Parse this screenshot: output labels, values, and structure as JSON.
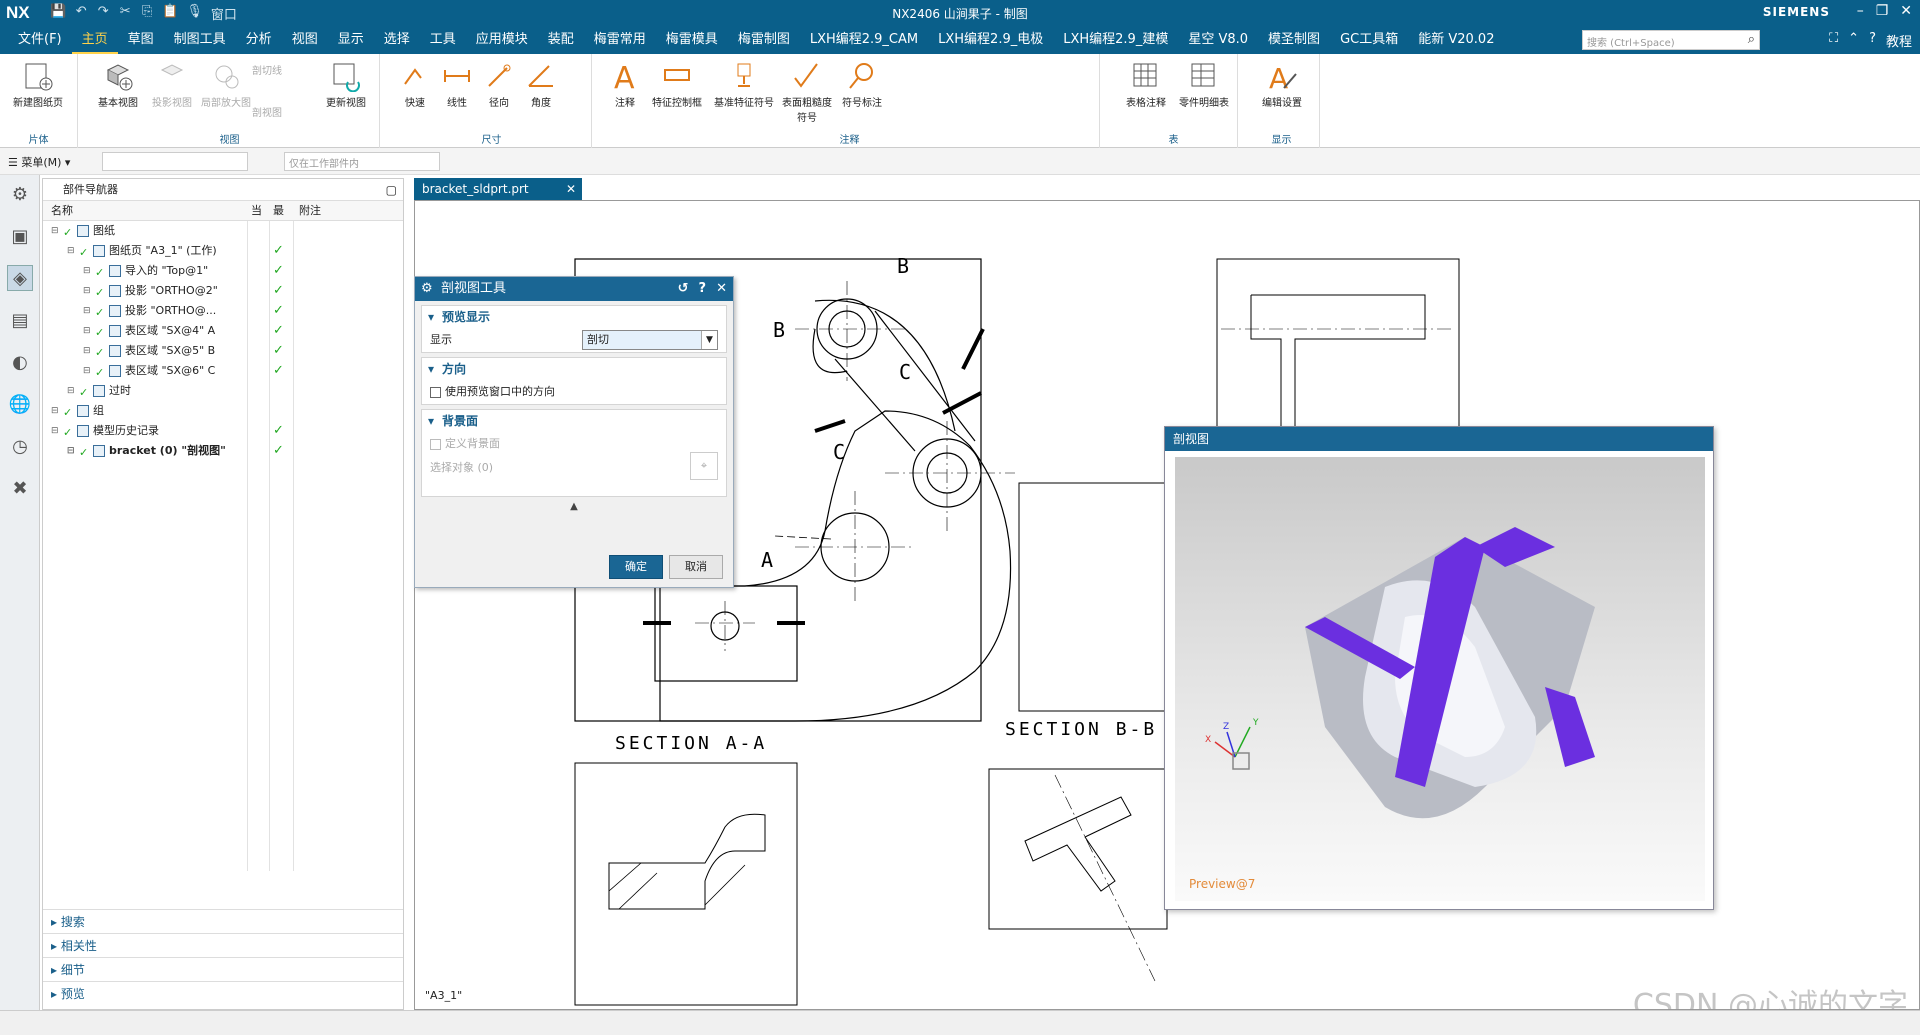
{
  "title_bar": {
    "logo": "NX",
    "window_title": "NX2406 山涧果子 - 制图",
    "brand": "SIEMENS",
    "window_menu_label": "窗口"
  },
  "menu": {
    "tabs": [
      "文件(F)",
      "主页",
      "草图",
      "制图工具",
      "分析",
      "视图",
      "显示",
      "选择",
      "工具",
      "应用模块",
      "装配",
      "梅雷常用",
      "梅雷模具",
      "梅雷制图",
      "LXH编程2.9_CAM",
      "LXH编程2.9_电极",
      "LXH编程2.9_建模",
      "星空 V8.0",
      "模圣制图",
      "GC工具箱",
      "能新 V20.02"
    ],
    "active_tab": "主页",
    "search_placeholder": "搜索 (Ctrl+Space)",
    "tutorial_label": "教程"
  },
  "ribbon": {
    "groups": [
      {
        "label": "片体",
        "buttons": [
          "新建图纸页"
        ]
      },
      {
        "label": "视图",
        "buttons": [
          "基本视图",
          "投影视图",
          "局部放大图",
          "剖切线",
          "剖视图",
          "更新视图"
        ]
      },
      {
        "label": "尺寸",
        "buttons": [
          "快速",
          "线性",
          "径向",
          "角度"
        ]
      },
      {
        "label": "注释",
        "buttons": [
          "注释",
          "特征控制框",
          "基准特征符号",
          "表面粗糙度符号",
          "符号标注"
        ]
      },
      {
        "label": "表",
        "buttons": [
          "表格注释",
          "零件明细表"
        ]
      },
      {
        "label": "显示",
        "buttons": [
          "编辑设置"
        ]
      }
    ]
  },
  "toolbar2": {
    "menu_label": "菜单(M)",
    "filter_placeholder": "仅在工作部件内"
  },
  "navigator": {
    "title": "部件导航器",
    "columns": [
      "名称",
      "当",
      "最",
      "附注"
    ],
    "rows": [
      {
        "text": "图纸",
        "indent": 0,
        "check": false
      },
      {
        "text": "图纸页 \"A3_1\" (工作)",
        "indent": 1,
        "check": true
      },
      {
        "text": "导入的 \"Top@1\"",
        "indent": 2,
        "check": true
      },
      {
        "text": "投影 \"ORTHO@2\"",
        "indent": 2,
        "check": true
      },
      {
        "text": "投影 \"ORTHO@...",
        "indent": 2,
        "check": true
      },
      {
        "text": "表区域 \"SX@4\" A",
        "indent": 2,
        "check": true
      },
      {
        "text": "表区域 \"SX@5\" B",
        "indent": 2,
        "check": true
      },
      {
        "text": "表区域 \"SX@6\" C",
        "indent": 2,
        "check": true
      },
      {
        "text": "过时",
        "indent": 1,
        "check": false
      },
      {
        "text": "组",
        "indent": 0,
        "check": false
      },
      {
        "text": "模型历史记录",
        "indent": 0,
        "check": true
      },
      {
        "text": "bracket (0) \"剖视图\"",
        "indent": 1,
        "check": true
      }
    ],
    "footer": [
      "搜索",
      "相关性",
      "细节",
      "预览"
    ]
  },
  "doc_tab": {
    "label": "bracket_sldprt.prt"
  },
  "drawing": {
    "section_aa": "SECTION A-A",
    "section_bb": "SECTION B-B",
    "sheet_name": "\"A3_1\"",
    "labels": [
      "B",
      "B",
      "C",
      "C",
      "A"
    ]
  },
  "dialog": {
    "title": "剖视图工具",
    "sec_preview": "预览显示",
    "display_label": "显示",
    "display_value": "剖切",
    "sec_orient": "方向",
    "use_preview_dir": "使用预览窗口中的方向",
    "sec_bg": "背景面",
    "define_bg": "定义背景面",
    "select_obj": "选择对象 (0)",
    "ok": "确定",
    "cancel": "取消"
  },
  "preview": {
    "title": "剖视图",
    "label": "Preview@7",
    "axes": [
      "X",
      "Y",
      "Z"
    ]
  },
  "watermark": "CSDN @心诚的文字"
}
